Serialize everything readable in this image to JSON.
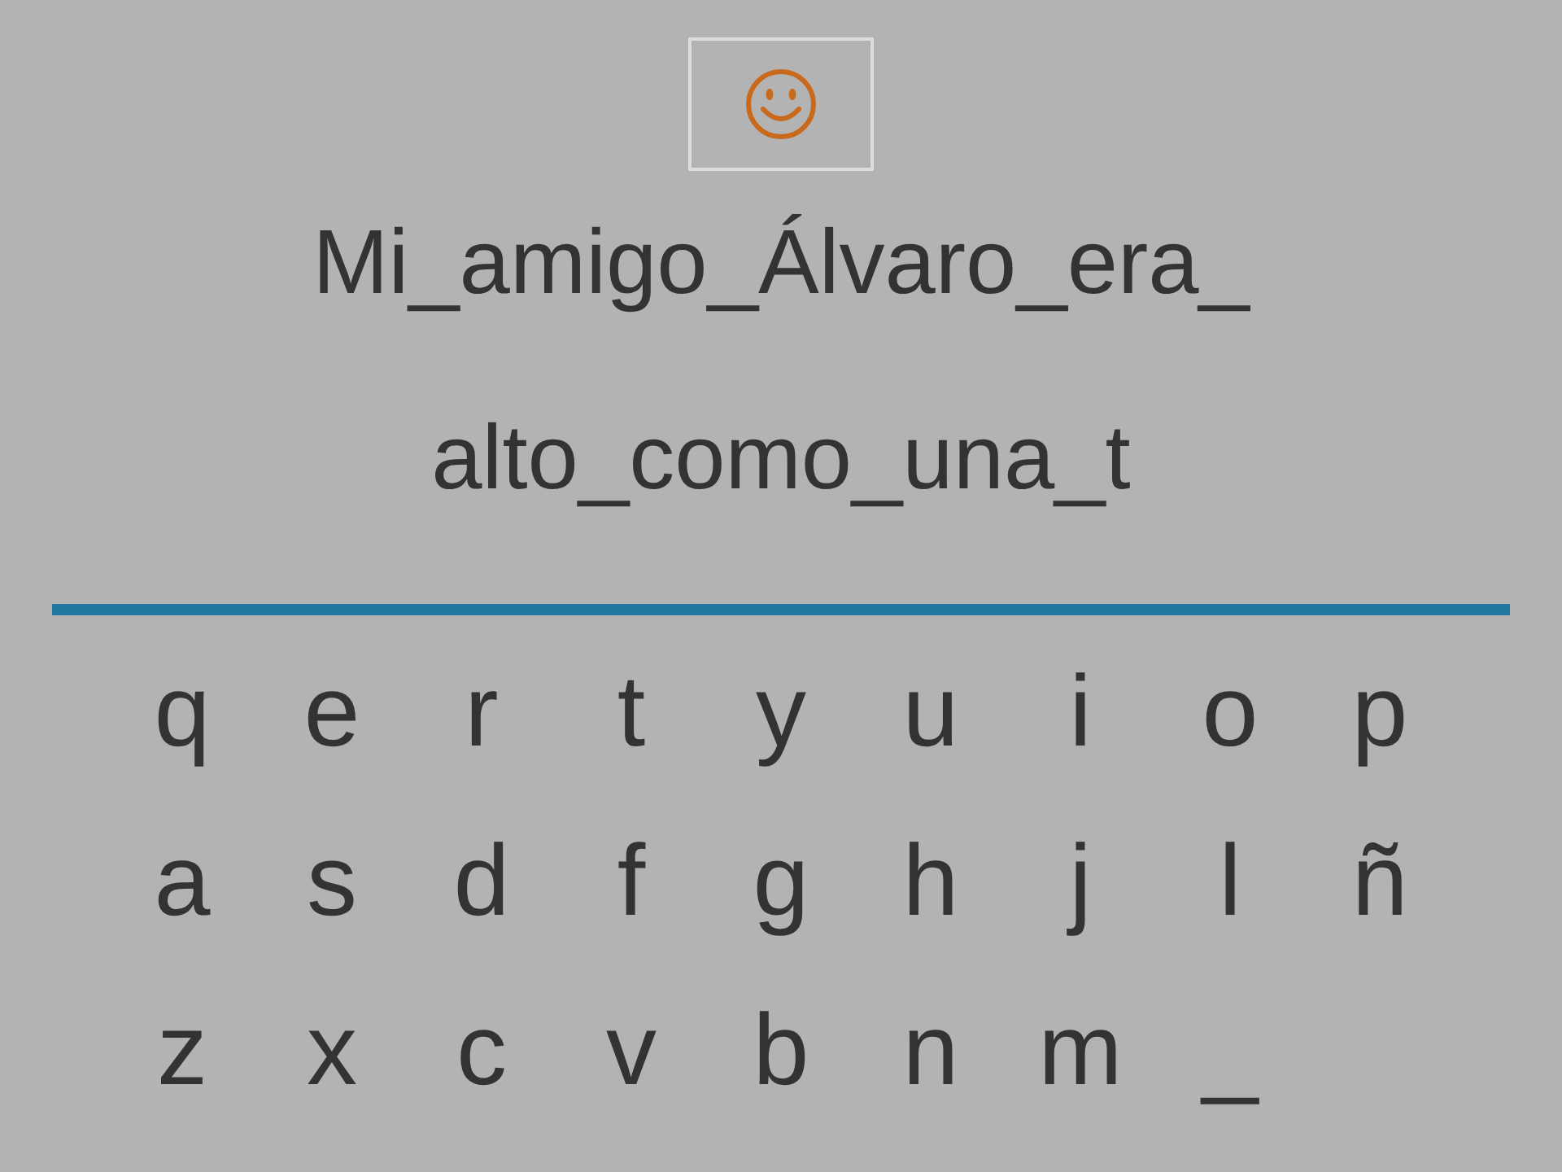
{
  "sentence_lines": [
    "Mi_amigo_Álvaro_era_",
    "alto_como_una_t"
  ],
  "keyboard_rows": [
    [
      "q",
      "e",
      "r",
      "t",
      "y",
      "u",
      "i",
      "o",
      "p"
    ],
    [
      "a",
      "s",
      "d",
      "f",
      "g",
      "h",
      "j",
      "l",
      "ñ"
    ],
    [
      "z",
      "x",
      "c",
      "v",
      "b",
      "n",
      "m",
      "_"
    ]
  ]
}
